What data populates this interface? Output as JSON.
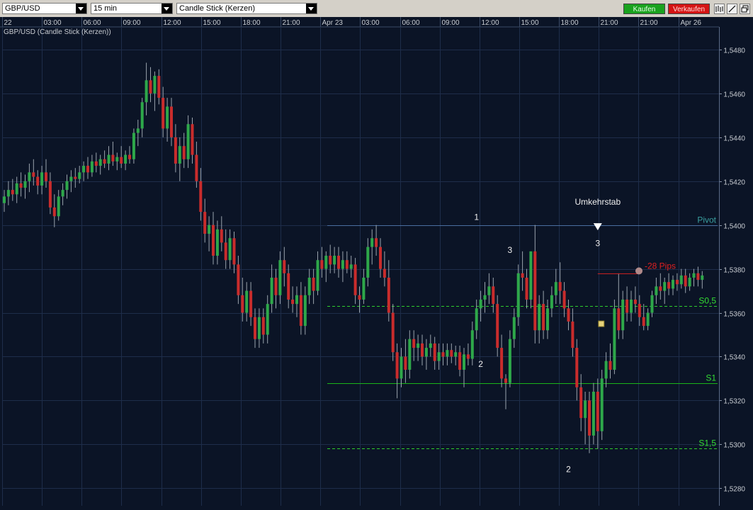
{
  "toolbar": {
    "symbol": "GBP/USD",
    "interval": "15 min",
    "chart_style": "Candle Stick (Kerzen)",
    "buy_label": "Kaufen",
    "sell_label": "Verkaufen",
    "icons": [
      "bars-icon",
      "draw-line-icon",
      "window-restore-icon"
    ]
  },
  "colors": {
    "background": "#0b1426",
    "grid": "#1e2d4a",
    "bull_candle": "#2ea84a",
    "bear_candle": "#c92c2c",
    "wick": "#9aa3ad",
    "pivot_line": "#4a6fa0",
    "support_line": "#19b419",
    "dashed_line": "#2ecc2e",
    "stop_line": "#c82020",
    "buy_button": "#1aa21f",
    "sell_button": "#d41414"
  },
  "chart_data": {
    "type": "candlestick",
    "title": "GBP/USD (Candle Stick (Kerzen))",
    "ylim": [
      1.5272,
      1.549
    ],
    "y_ticks": [
      "1,5280",
      "1,5300",
      "1,5320",
      "1,5340",
      "1,5360",
      "1,5380",
      "1,5400",
      "1,5420",
      "1,5440",
      "1,5460",
      "1,5480"
    ],
    "x_ticks": [
      "22",
      "03:00",
      "06:00",
      "09:00",
      "12:00",
      "15:00",
      "18:00",
      "21:00",
      "Apr 23",
      "03:00",
      "06:00",
      "09:00",
      "12:00",
      "15:00",
      "18:00",
      "21:00",
      "21:00",
      "Apr 26"
    ],
    "grid": true,
    "candles": [
      {
        "o": 1.541,
        "h": 1.5416,
        "l": 1.5406,
        "c": 1.5413
      },
      {
        "o": 1.5413,
        "h": 1.542,
        "l": 1.5409,
        "c": 1.5416
      },
      {
        "o": 1.5416,
        "h": 1.5421,
        "l": 1.5411,
        "c": 1.5414
      },
      {
        "o": 1.5414,
        "h": 1.5422,
        "l": 1.541,
        "c": 1.5419
      },
      {
        "o": 1.5419,
        "h": 1.5424,
        "l": 1.5413,
        "c": 1.5417
      },
      {
        "o": 1.5417,
        "h": 1.5423,
        "l": 1.5412,
        "c": 1.542
      },
      {
        "o": 1.542,
        "h": 1.5428,
        "l": 1.5415,
        "c": 1.5424
      },
      {
        "o": 1.5424,
        "h": 1.543,
        "l": 1.5418,
        "c": 1.5422
      },
      {
        "o": 1.5422,
        "h": 1.5425,
        "l": 1.5414,
        "c": 1.5418
      },
      {
        "o": 1.5418,
        "h": 1.5427,
        "l": 1.5414,
        "c": 1.5424
      },
      {
        "o": 1.5424,
        "h": 1.543,
        "l": 1.5417,
        "c": 1.542
      },
      {
        "o": 1.542,
        "h": 1.5424,
        "l": 1.5405,
        "c": 1.5408
      },
      {
        "o": 1.5408,
        "h": 1.5414,
        "l": 1.5399,
        "c": 1.5404
      },
      {
        "o": 1.5404,
        "h": 1.5416,
        "l": 1.5402,
        "c": 1.5413
      },
      {
        "o": 1.5413,
        "h": 1.5419,
        "l": 1.5409,
        "c": 1.5416
      },
      {
        "o": 1.5416,
        "h": 1.5423,
        "l": 1.5412,
        "c": 1.542
      },
      {
        "o": 1.542,
        "h": 1.5425,
        "l": 1.5415,
        "c": 1.5422
      },
      {
        "o": 1.5422,
        "h": 1.5426,
        "l": 1.5417,
        "c": 1.5421
      },
      {
        "o": 1.5421,
        "h": 1.5427,
        "l": 1.5419,
        "c": 1.5424
      },
      {
        "o": 1.5424,
        "h": 1.5429,
        "l": 1.542,
        "c": 1.5427
      },
      {
        "o": 1.5427,
        "h": 1.5431,
        "l": 1.5421,
        "c": 1.5424
      },
      {
        "o": 1.5424,
        "h": 1.5432,
        "l": 1.5422,
        "c": 1.5429
      },
      {
        "o": 1.5429,
        "h": 1.5433,
        "l": 1.5424,
        "c": 1.5427
      },
      {
        "o": 1.5427,
        "h": 1.5432,
        "l": 1.5423,
        "c": 1.543
      },
      {
        "o": 1.543,
        "h": 1.5434,
        "l": 1.5426,
        "c": 1.5428
      },
      {
        "o": 1.5428,
        "h": 1.5436,
        "l": 1.5425,
        "c": 1.5432
      },
      {
        "o": 1.5432,
        "h": 1.5438,
        "l": 1.5427,
        "c": 1.5429
      },
      {
        "o": 1.5429,
        "h": 1.5433,
        "l": 1.5425,
        "c": 1.5431
      },
      {
        "o": 1.5431,
        "h": 1.5436,
        "l": 1.5426,
        "c": 1.5428
      },
      {
        "o": 1.5428,
        "h": 1.5434,
        "l": 1.5425,
        "c": 1.5432
      },
      {
        "o": 1.5432,
        "h": 1.5436,
        "l": 1.5428,
        "c": 1.543
      },
      {
        "o": 1.543,
        "h": 1.5444,
        "l": 1.5428,
        "c": 1.5442
      },
      {
        "o": 1.5442,
        "h": 1.5448,
        "l": 1.5436,
        "c": 1.5444
      },
      {
        "o": 1.5444,
        "h": 1.5458,
        "l": 1.544,
        "c": 1.5456
      },
      {
        "o": 1.5456,
        "h": 1.5474,
        "l": 1.545,
        "c": 1.5466
      },
      {
        "o": 1.5466,
        "h": 1.5472,
        "l": 1.5456,
        "c": 1.546
      },
      {
        "o": 1.546,
        "h": 1.547,
        "l": 1.5452,
        "c": 1.5468
      },
      {
        "o": 1.5468,
        "h": 1.5471,
        "l": 1.5455,
        "c": 1.5458
      },
      {
        "o": 1.5458,
        "h": 1.5463,
        "l": 1.544,
        "c": 1.5444
      },
      {
        "o": 1.5444,
        "h": 1.5458,
        "l": 1.5438,
        "c": 1.5454
      },
      {
        "o": 1.5454,
        "h": 1.5458,
        "l": 1.5436,
        "c": 1.544
      },
      {
        "o": 1.544,
        "h": 1.5446,
        "l": 1.5424,
        "c": 1.5428
      },
      {
        "o": 1.5428,
        "h": 1.544,
        "l": 1.542,
        "c": 1.5436
      },
      {
        "o": 1.5436,
        "h": 1.5442,
        "l": 1.5426,
        "c": 1.543
      },
      {
        "o": 1.543,
        "h": 1.545,
        "l": 1.5426,
        "c": 1.5446
      },
      {
        "o": 1.5446,
        "h": 1.5449,
        "l": 1.5428,
        "c": 1.5432
      },
      {
        "o": 1.5432,
        "h": 1.5438,
        "l": 1.5417,
        "c": 1.542
      },
      {
        "o": 1.542,
        "h": 1.5426,
        "l": 1.5402,
        "c": 1.5406
      },
      {
        "o": 1.5406,
        "h": 1.5412,
        "l": 1.5392,
        "c": 1.5396
      },
      {
        "o": 1.5396,
        "h": 1.5404,
        "l": 1.5388,
        "c": 1.54
      },
      {
        "o": 1.54,
        "h": 1.5406,
        "l": 1.5382,
        "c": 1.5386
      },
      {
        "o": 1.5386,
        "h": 1.5402,
        "l": 1.5382,
        "c": 1.5398
      },
      {
        "o": 1.5398,
        "h": 1.5404,
        "l": 1.5388,
        "c": 1.5392
      },
      {
        "o": 1.5392,
        "h": 1.5398,
        "l": 1.538,
        "c": 1.5384
      },
      {
        "o": 1.5384,
        "h": 1.5398,
        "l": 1.538,
        "c": 1.5394
      },
      {
        "o": 1.5394,
        "h": 1.5397,
        "l": 1.5378,
        "c": 1.5382
      },
      {
        "o": 1.5382,
        "h": 1.5386,
        "l": 1.5364,
        "c": 1.5368
      },
      {
        "o": 1.5368,
        "h": 1.5376,
        "l": 1.5356,
        "c": 1.536
      },
      {
        "o": 1.536,
        "h": 1.5374,
        "l": 1.5356,
        "c": 1.537
      },
      {
        "o": 1.537,
        "h": 1.5374,
        "l": 1.5354,
        "c": 1.5358
      },
      {
        "o": 1.5358,
        "h": 1.5362,
        "l": 1.5344,
        "c": 1.5348
      },
      {
        "o": 1.5348,
        "h": 1.5362,
        "l": 1.5344,
        "c": 1.5358
      },
      {
        "o": 1.5358,
        "h": 1.5362,
        "l": 1.5346,
        "c": 1.535
      },
      {
        "o": 1.535,
        "h": 1.5368,
        "l": 1.5346,
        "c": 1.5364
      },
      {
        "o": 1.5364,
        "h": 1.5382,
        "l": 1.536,
        "c": 1.5376
      },
      {
        "o": 1.5376,
        "h": 1.538,
        "l": 1.5362,
        "c": 1.5368
      },
      {
        "o": 1.5368,
        "h": 1.5388,
        "l": 1.5364,
        "c": 1.5384
      },
      {
        "o": 1.5384,
        "h": 1.539,
        "l": 1.5372,
        "c": 1.5378
      },
      {
        "o": 1.5378,
        "h": 1.5382,
        "l": 1.5362,
        "c": 1.5366
      },
      {
        "o": 1.5366,
        "h": 1.5372,
        "l": 1.536,
        "c": 1.5364
      },
      {
        "o": 1.5364,
        "h": 1.5372,
        "l": 1.5358,
        "c": 1.5368
      },
      {
        "o": 1.5368,
        "h": 1.5374,
        "l": 1.535,
        "c": 1.5354
      },
      {
        "o": 1.5354,
        "h": 1.5372,
        "l": 1.535,
        "c": 1.5368
      },
      {
        "o": 1.5368,
        "h": 1.538,
        "l": 1.5364,
        "c": 1.5376
      },
      {
        "o": 1.5376,
        "h": 1.538,
        "l": 1.5364,
        "c": 1.537
      },
      {
        "o": 1.537,
        "h": 1.5388,
        "l": 1.5368,
        "c": 1.5384
      },
      {
        "o": 1.5384,
        "h": 1.539,
        "l": 1.5376,
        "c": 1.538
      },
      {
        "o": 1.538,
        "h": 1.5388,
        "l": 1.5374,
        "c": 1.5386
      },
      {
        "o": 1.5386,
        "h": 1.5391,
        "l": 1.5378,
        "c": 1.5382
      },
      {
        "o": 1.5382,
        "h": 1.539,
        "l": 1.5378,
        "c": 1.5386
      },
      {
        "o": 1.5386,
        "h": 1.539,
        "l": 1.5376,
        "c": 1.538
      },
      {
        "o": 1.538,
        "h": 1.5388,
        "l": 1.5374,
        "c": 1.5384
      },
      {
        "o": 1.5384,
        "h": 1.5388,
        "l": 1.5378,
        "c": 1.538
      },
      {
        "o": 1.538,
        "h": 1.5386,
        "l": 1.5376,
        "c": 1.5382
      },
      {
        "o": 1.5382,
        "h": 1.5385,
        "l": 1.5364,
        "c": 1.5368
      },
      {
        "o": 1.5368,
        "h": 1.5372,
        "l": 1.536,
        "c": 1.5366
      },
      {
        "o": 1.5366,
        "h": 1.538,
        "l": 1.5364,
        "c": 1.5376
      },
      {
        "o": 1.5376,
        "h": 1.5394,
        "l": 1.5372,
        "c": 1.539
      },
      {
        "o": 1.539,
        "h": 1.5398,
        "l": 1.5382,
        "c": 1.5394
      },
      {
        "o": 1.5394,
        "h": 1.54,
        "l": 1.5386,
        "c": 1.539
      },
      {
        "o": 1.539,
        "h": 1.5394,
        "l": 1.5376,
        "c": 1.538
      },
      {
        "o": 1.538,
        "h": 1.5388,
        "l": 1.5372,
        "c": 1.5376
      },
      {
        "o": 1.5376,
        "h": 1.5384,
        "l": 1.5356,
        "c": 1.536
      },
      {
        "o": 1.536,
        "h": 1.5364,
        "l": 1.5338,
        "c": 1.5342
      },
      {
        "o": 1.5342,
        "h": 1.5346,
        "l": 1.5321,
        "c": 1.533
      },
      {
        "o": 1.533,
        "h": 1.5344,
        "l": 1.5326,
        "c": 1.534
      },
      {
        "o": 1.534,
        "h": 1.5348,
        "l": 1.5328,
        "c": 1.5334
      },
      {
        "o": 1.5334,
        "h": 1.5352,
        "l": 1.533,
        "c": 1.5348
      },
      {
        "o": 1.5348,
        "h": 1.5352,
        "l": 1.5338,
        "c": 1.5344
      },
      {
        "o": 1.5344,
        "h": 1.535,
        "l": 1.5338,
        "c": 1.5346
      },
      {
        "o": 1.5346,
        "h": 1.535,
        "l": 1.5336,
        "c": 1.534
      },
      {
        "o": 1.534,
        "h": 1.5348,
        "l": 1.5334,
        "c": 1.5344
      },
      {
        "o": 1.5344,
        "h": 1.535,
        "l": 1.534,
        "c": 1.5346
      },
      {
        "o": 1.5346,
        "h": 1.5349,
        "l": 1.5334,
        "c": 1.5338
      },
      {
        "o": 1.5338,
        "h": 1.5346,
        "l": 1.5334,
        "c": 1.5342
      },
      {
        "o": 1.5342,
        "h": 1.5346,
        "l": 1.5336,
        "c": 1.534
      },
      {
        "o": 1.534,
        "h": 1.5346,
        "l": 1.5336,
        "c": 1.5343
      },
      {
        "o": 1.5343,
        "h": 1.5346,
        "l": 1.5337,
        "c": 1.534
      },
      {
        "o": 1.534,
        "h": 1.5345,
        "l": 1.5336,
        "c": 1.5342
      },
      {
        "o": 1.5342,
        "h": 1.5345,
        "l": 1.5331,
        "c": 1.5334
      },
      {
        "o": 1.5334,
        "h": 1.5344,
        "l": 1.5326,
        "c": 1.5341
      },
      {
        "o": 1.5341,
        "h": 1.5346,
        "l": 1.5336,
        "c": 1.5339
      },
      {
        "o": 1.5339,
        "h": 1.5356,
        "l": 1.5336,
        "c": 1.5352
      },
      {
        "o": 1.5352,
        "h": 1.5366,
        "l": 1.5348,
        "c": 1.5362
      },
      {
        "o": 1.5362,
        "h": 1.537,
        "l": 1.5356,
        "c": 1.5366
      },
      {
        "o": 1.5366,
        "h": 1.5374,
        "l": 1.536,
        "c": 1.5368
      },
      {
        "o": 1.5368,
        "h": 1.5378,
        "l": 1.5364,
        "c": 1.5372
      },
      {
        "o": 1.5372,
        "h": 1.5376,
        "l": 1.536,
        "c": 1.5364
      },
      {
        "o": 1.5364,
        "h": 1.5368,
        "l": 1.534,
        "c": 1.5344
      },
      {
        "o": 1.5344,
        "h": 1.535,
        "l": 1.5326,
        "c": 1.533
      },
      {
        "o": 1.533,
        "h": 1.5332,
        "l": 1.5316,
        "c": 1.5328
      },
      {
        "o": 1.5328,
        "h": 1.5352,
        "l": 1.5326,
        "c": 1.5348
      },
      {
        "o": 1.5348,
        "h": 1.5362,
        "l": 1.5344,
        "c": 1.5358
      },
      {
        "o": 1.5358,
        "h": 1.5382,
        "l": 1.5354,
        "c": 1.5378
      },
      {
        "o": 1.5378,
        "h": 1.5388,
        "l": 1.537,
        "c": 1.5376
      },
      {
        "o": 1.5376,
        "h": 1.538,
        "l": 1.5362,
        "c": 1.5366
      },
      {
        "o": 1.5366,
        "h": 1.5386,
        "l": 1.5362,
        "c": 1.5388
      },
      {
        "o": 1.5388,
        "h": 1.54,
        "l": 1.5346,
        "c": 1.5352
      },
      {
        "o": 1.5352,
        "h": 1.5368,
        "l": 1.5346,
        "c": 1.5364
      },
      {
        "o": 1.5364,
        "h": 1.537,
        "l": 1.5348,
        "c": 1.5352
      },
      {
        "o": 1.5352,
        "h": 1.5366,
        "l": 1.5348,
        "c": 1.5362
      },
      {
        "o": 1.5362,
        "h": 1.5372,
        "l": 1.5358,
        "c": 1.5368
      },
      {
        "o": 1.5368,
        "h": 1.538,
        "l": 1.5364,
        "c": 1.5374
      },
      {
        "o": 1.5374,
        "h": 1.5383,
        "l": 1.5364,
        "c": 1.537
      },
      {
        "o": 1.537,
        "h": 1.5374,
        "l": 1.5358,
        "c": 1.5362
      },
      {
        "o": 1.5362,
        "h": 1.5366,
        "l": 1.5352,
        "c": 1.5356
      },
      {
        "o": 1.5356,
        "h": 1.5362,
        "l": 1.534,
        "c": 1.5344
      },
      {
        "o": 1.5344,
        "h": 1.5348,
        "l": 1.532,
        "c": 1.5326
      },
      {
        "o": 1.5326,
        "h": 1.5332,
        "l": 1.5306,
        "c": 1.5312
      },
      {
        "o": 1.5312,
        "h": 1.5324,
        "l": 1.53,
        "c": 1.532
      },
      {
        "o": 1.532,
        "h": 1.5324,
        "l": 1.5296,
        "c": 1.5304
      },
      {
        "o": 1.5304,
        "h": 1.5328,
        "l": 1.53,
        "c": 1.5324
      },
      {
        "o": 1.5324,
        "h": 1.533,
        "l": 1.5298,
        "c": 1.5306
      },
      {
        "o": 1.5306,
        "h": 1.5334,
        "l": 1.5302,
        "c": 1.533
      },
      {
        "o": 1.533,
        "h": 1.5342,
        "l": 1.5326,
        "c": 1.5338
      },
      {
        "o": 1.5338,
        "h": 1.5346,
        "l": 1.533,
        "c": 1.5334
      },
      {
        "o": 1.5334,
        "h": 1.5366,
        "l": 1.5332,
        "c": 1.5362
      },
      {
        "o": 1.5362,
        "h": 1.5378,
        "l": 1.5348,
        "c": 1.5352
      },
      {
        "o": 1.5352,
        "h": 1.537,
        "l": 1.5348,
        "c": 1.5366
      },
      {
        "o": 1.5366,
        "h": 1.5372,
        "l": 1.5356,
        "c": 1.536
      },
      {
        "o": 1.536,
        "h": 1.537,
        "l": 1.5356,
        "c": 1.5366
      },
      {
        "o": 1.5366,
        "h": 1.5372,
        "l": 1.536,
        "c": 1.5364
      },
      {
        "o": 1.5364,
        "h": 1.5368,
        "l": 1.5354,
        "c": 1.5358
      },
      {
        "o": 1.5358,
        "h": 1.5364,
        "l": 1.5352,
        "c": 1.5354
      },
      {
        "o": 1.5354,
        "h": 1.5362,
        "l": 1.5352,
        "c": 1.536
      },
      {
        "o": 1.536,
        "h": 1.537,
        "l": 1.5358,
        "c": 1.5368
      },
      {
        "o": 1.5368,
        "h": 1.5376,
        "l": 1.5364,
        "c": 1.5372
      },
      {
        "o": 1.5372,
        "h": 1.5378,
        "l": 1.5366,
        "c": 1.537
      },
      {
        "o": 1.537,
        "h": 1.5376,
        "l": 1.5364,
        "c": 1.5374
      },
      {
        "o": 1.5374,
        "h": 1.5378,
        "l": 1.5368,
        "c": 1.5371
      },
      {
        "o": 1.5371,
        "h": 1.5377,
        "l": 1.5368,
        "c": 1.5375
      },
      {
        "o": 1.5375,
        "h": 1.5378,
        "l": 1.537,
        "c": 1.5373
      },
      {
        "o": 1.5373,
        "h": 1.538,
        "l": 1.5371,
        "c": 1.5377
      },
      {
        "o": 1.5377,
        "h": 1.538,
        "l": 1.5369,
        "c": 1.5372
      },
      {
        "o": 1.5372,
        "h": 1.5378,
        "l": 1.537,
        "c": 1.5376
      },
      {
        "o": 1.5376,
        "h": 1.538,
        "l": 1.5372,
        "c": 1.5378
      },
      {
        "o": 1.5378,
        "h": 1.5381,
        "l": 1.5372,
        "c": 1.5375
      },
      {
        "o": 1.5375,
        "h": 1.5379,
        "l": 1.5371,
        "c": 1.5377
      }
    ],
    "levels": [
      {
        "label": "Pivot",
        "value": 1.54,
        "style": "solid"
      },
      {
        "label": "S0,5",
        "value": 1.5363,
        "style": "dashed"
      },
      {
        "label": "S1",
        "value": 1.5328,
        "style": "solid"
      },
      {
        "label": "S1,5",
        "value": 1.5298,
        "style": "dashed"
      }
    ],
    "wave_labels": [
      {
        "text": "1",
        "candle": 113,
        "value": 1.5401
      },
      {
        "text": "2",
        "candle": 114,
        "value": 1.5334
      },
      {
        "text": "3",
        "candle": 121,
        "value": 1.5386
      },
      {
        "text": "2",
        "candle": 135,
        "value": 1.5286
      },
      {
        "text": "3",
        "candle": 142,
        "value": 1.5389
      }
    ],
    "reversal_label": {
      "text": "Umkehrstab",
      "candle": 142,
      "value": 1.5395
    },
    "stop_label": "-28 Pips",
    "stop_level": 1.5378
  }
}
